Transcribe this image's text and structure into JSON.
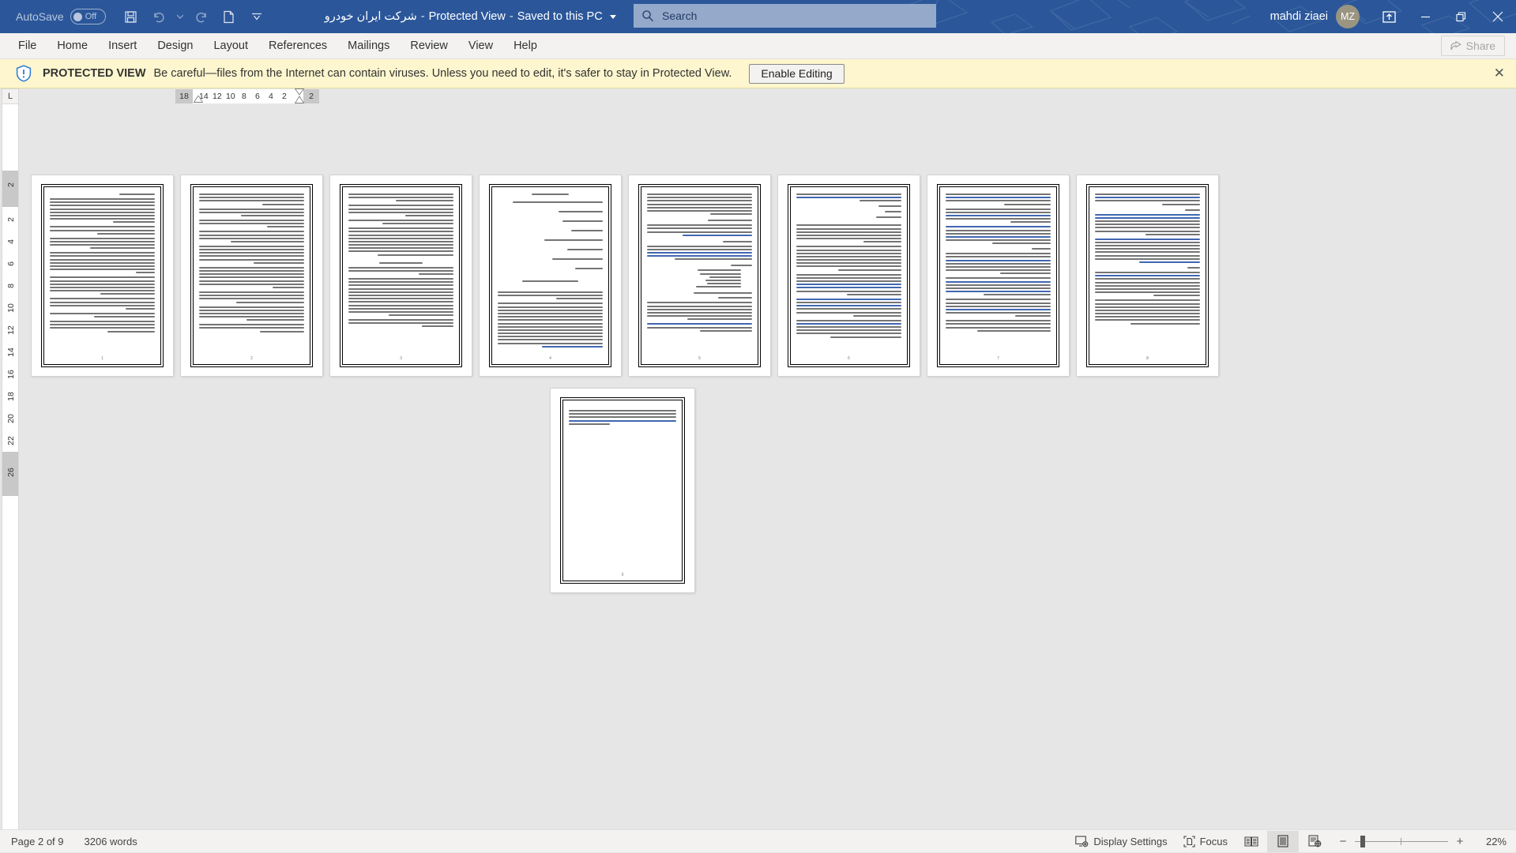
{
  "titlebar": {
    "autosave_label": "AutoSave",
    "autosave_state": "Off",
    "doc_name": "شرکت ایران خودرو",
    "protected_view": "Protected View",
    "saved_state": "Saved to this PC",
    "sep": "-",
    "quick_access": [
      {
        "name": "save-button",
        "icon": "save-icon"
      },
      {
        "name": "undo-button",
        "icon": "undo-icon"
      },
      {
        "name": "redo-button",
        "icon": "redo-icon"
      },
      {
        "name": "new-document-button",
        "icon": "document-icon"
      },
      {
        "name": "customize-quick-access-button",
        "icon": "chevron-down-icon"
      }
    ],
    "user_name": "mahdi ziaei",
    "user_initials": "MZ",
    "ribbon_display_options": "ribbon-display-options-icon",
    "minimize": "minimize-icon",
    "restore": "restore-icon",
    "close": "close-icon"
  },
  "search": {
    "placeholder": "Search",
    "value": "",
    "icon": "search-icon"
  },
  "ribbon": {
    "tabs": [
      {
        "label": "File"
      },
      {
        "label": "Home"
      },
      {
        "label": "Insert"
      },
      {
        "label": "Design"
      },
      {
        "label": "Layout"
      },
      {
        "label": "References"
      },
      {
        "label": "Mailings"
      },
      {
        "label": "Review"
      },
      {
        "label": "View"
      },
      {
        "label": "Help"
      }
    ],
    "share_label": "Share"
  },
  "protected_view": {
    "icon": "shield-info-icon",
    "title": "PROTECTED VIEW",
    "message": "Be careful—files from the Internet can contain viruses. Unless you need to edit, it's safer to stay in Protected View.",
    "enable_editing_label": "Enable Editing",
    "close_label": "✕"
  },
  "rulers": {
    "corner_label": "L",
    "horizontal_ticks": [
      "18",
      "14",
      "12",
      "10",
      "8",
      "6",
      "4",
      "2",
      "2"
    ],
    "vertical_ticks": [
      "2",
      "2",
      "4",
      "6",
      "8",
      "10",
      "12",
      "14",
      "16",
      "18",
      "20",
      "22",
      "26"
    ]
  },
  "statusbar": {
    "page_indicator": "Page 2 of 9",
    "word_count": "3206 words",
    "display_settings_label": "Display Settings",
    "display_settings_icon": "display-settings-icon",
    "focus_label": "Focus",
    "focus_icon": "focus-icon",
    "views": [
      {
        "name": "read-mode-view-button",
        "icon": "read-mode-icon",
        "active": false
      },
      {
        "name": "print-layout-view-button",
        "icon": "print-layout-icon",
        "active": true
      },
      {
        "name": "web-layout-view-button",
        "icon": "web-layout-icon",
        "active": false
      }
    ],
    "zoom_out": "−",
    "zoom_in": "+",
    "zoom_level": "22%"
  },
  "document": {
    "zoom_percent": 22,
    "pages_in_row": 8,
    "total_pages": 9,
    "language": "fa",
    "direction": "rtl",
    "last_page_number": "9",
    "page_numbers": [
      "1",
      "2",
      "3",
      "4",
      "5",
      "6",
      "7",
      "8",
      "9"
    ]
  }
}
